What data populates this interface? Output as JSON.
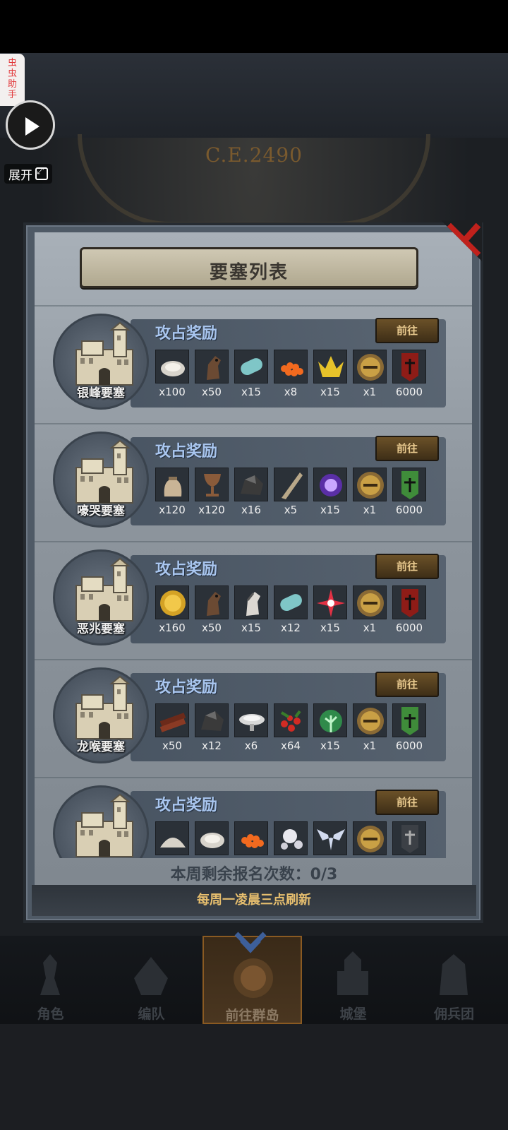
{
  "background": {
    "era_text": "C.E.2490"
  },
  "helper": {
    "tab_text": [
      "虫",
      "虫",
      "助",
      "手"
    ],
    "expand_label": "展开"
  },
  "dialog": {
    "title": "要塞列表",
    "remaining_label": "本周剩余报名次数：",
    "remaining_value": "0/3",
    "refresh_note": "每周一凌晨三点刷新"
  },
  "forts": [
    {
      "name": "银峰要塞",
      "reward_title": "攻占奖励",
      "goto_label": "前往",
      "items": [
        {
          "icon": "oyster-icon",
          "qty": "x100"
        },
        {
          "icon": "horse-icon",
          "qty": "x50"
        },
        {
          "icon": "cloth-roll-icon",
          "qty": "x15"
        },
        {
          "icon": "roe-icon",
          "qty": "x8"
        },
        {
          "icon": "gold-crown-icon",
          "qty": "x15"
        },
        {
          "icon": "knight-helmet-icon",
          "qty": "x1"
        },
        {
          "icon": "red-banner-icon",
          "qty": "6000"
        }
      ]
    },
    {
      "name": "嚎哭要塞",
      "reward_title": "攻占奖励",
      "goto_label": "前往",
      "items": [
        {
          "icon": "sack-icon",
          "qty": "x120"
        },
        {
          "icon": "chalice-icon",
          "qty": "x120"
        },
        {
          "icon": "ore-icon",
          "qty": "x16"
        },
        {
          "icon": "horn-icon",
          "qty": "x5"
        },
        {
          "icon": "purple-gem-icon",
          "qty": "x15"
        },
        {
          "icon": "knight-helmet-icon",
          "qty": "x1"
        },
        {
          "icon": "green-banner-icon",
          "qty": "6000"
        }
      ]
    },
    {
      "name": "恶兆要塞",
      "reward_title": "攻占奖励",
      "goto_label": "前往",
      "items": [
        {
          "icon": "gold-coin-icon",
          "qty": "x160"
        },
        {
          "icon": "horse-icon",
          "qty": "x50"
        },
        {
          "icon": "white-horse-icon",
          "qty": "x15"
        },
        {
          "icon": "cloth-roll-icon",
          "qty": "x12"
        },
        {
          "icon": "red-star-icon",
          "qty": "x15"
        },
        {
          "icon": "knight-helmet-icon",
          "qty": "x1"
        },
        {
          "icon": "red-banner-icon",
          "qty": "6000"
        }
      ]
    },
    {
      "name": "龙喉要塞",
      "reward_title": "攻占奖励",
      "goto_label": "前往",
      "items": [
        {
          "icon": "wood-planks-icon",
          "qty": "x50"
        },
        {
          "icon": "ore-icon",
          "qty": "x12"
        },
        {
          "icon": "salt-bowl-icon",
          "qty": "x6"
        },
        {
          "icon": "berries-icon",
          "qty": "x64"
        },
        {
          "icon": "green-tree-icon",
          "qty": "x15"
        },
        {
          "icon": "knight-helmet-icon",
          "qty": "x1"
        },
        {
          "icon": "green-banner-icon",
          "qty": "6000"
        }
      ]
    },
    {
      "name": "",
      "reward_title": "攻占奖励",
      "goto_label": "前往",
      "items": [
        {
          "icon": "flour-pile-icon",
          "qty": ""
        },
        {
          "icon": "oyster-icon",
          "qty": ""
        },
        {
          "icon": "roe-icon",
          "qty": ""
        },
        {
          "icon": "pearls-icon",
          "qty": ""
        },
        {
          "icon": "wings-crest-icon",
          "qty": ""
        },
        {
          "icon": "knight-helmet-icon",
          "qty": ""
        },
        {
          "icon": "grey-banner-icon",
          "qty": ""
        }
      ]
    }
  ],
  "nav": {
    "items": [
      {
        "label": "角色"
      },
      {
        "label": "编队"
      },
      {
        "label": "前往群岛"
      },
      {
        "label": "城堡"
      },
      {
        "label": "佣兵团"
      }
    ],
    "active_index": 2
  }
}
